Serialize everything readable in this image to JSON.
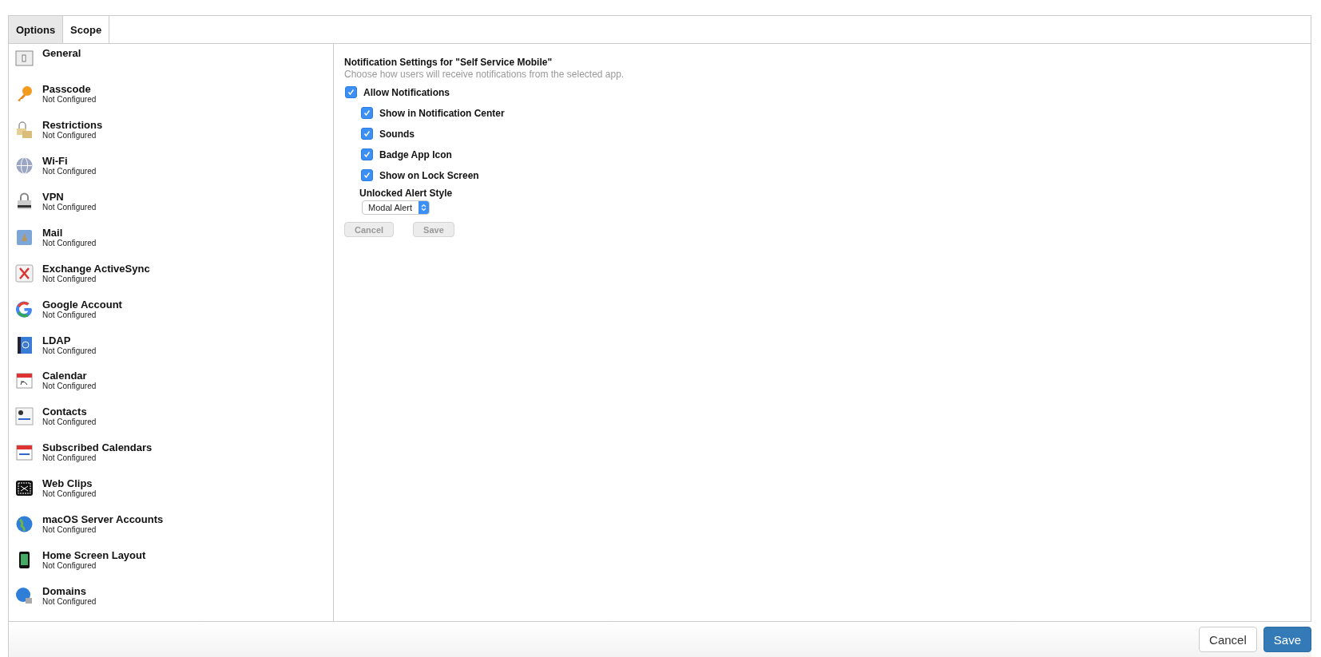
{
  "tabs": [
    {
      "label": "Options",
      "selected": true
    },
    {
      "label": "Scope",
      "selected": false
    }
  ],
  "sidebar": {
    "items": [
      {
        "title": "General"
      },
      {
        "title": "Passcode",
        "status": "Not Configured"
      },
      {
        "title": "Restrictions",
        "status": "Not Configured"
      },
      {
        "title": "Wi-Fi",
        "status": "Not Configured"
      },
      {
        "title": "VPN",
        "status": "Not Configured"
      },
      {
        "title": "Mail",
        "status": "Not Configured"
      },
      {
        "title": "Exchange ActiveSync",
        "status": "Not Configured"
      },
      {
        "title": "Google Account",
        "status": "Not Configured"
      },
      {
        "title": "LDAP",
        "status": "Not Configured"
      },
      {
        "title": "Calendar",
        "status": "Not Configured"
      },
      {
        "title": "Contacts",
        "status": "Not Configured"
      },
      {
        "title": "Subscribed Calendars",
        "status": "Not Configured"
      },
      {
        "title": "Web Clips",
        "status": "Not Configured"
      },
      {
        "title": "macOS Server Accounts",
        "status": "Not Configured"
      },
      {
        "title": "Home Screen Layout",
        "status": "Not Configured"
      },
      {
        "title": "Domains",
        "status": "Not Configured"
      }
    ]
  },
  "settings": {
    "title": "Notification Settings for \"Self Service Mobile\"",
    "description": "Choose how users will receive notifications from the selected app.",
    "allow": {
      "label": "Allow Notifications",
      "checked": true
    },
    "options": [
      {
        "label": "Show in Notification Center",
        "checked": true
      },
      {
        "label": "Sounds",
        "checked": true
      },
      {
        "label": "Badge App Icon",
        "checked": true
      },
      {
        "label": "Show on Lock Screen",
        "checked": true
      }
    ],
    "alert_style": {
      "label": "Unlocked Alert Style",
      "value": "Modal Alert"
    },
    "buttons": [
      {
        "label": "Cancel",
        "disabled": true
      },
      {
        "label": "Save",
        "disabled": true
      }
    ]
  },
  "footer": {
    "buttons": [
      {
        "label": "Cancel",
        "kind": "default"
      },
      {
        "label": "Save",
        "kind": "primary"
      }
    ]
  }
}
